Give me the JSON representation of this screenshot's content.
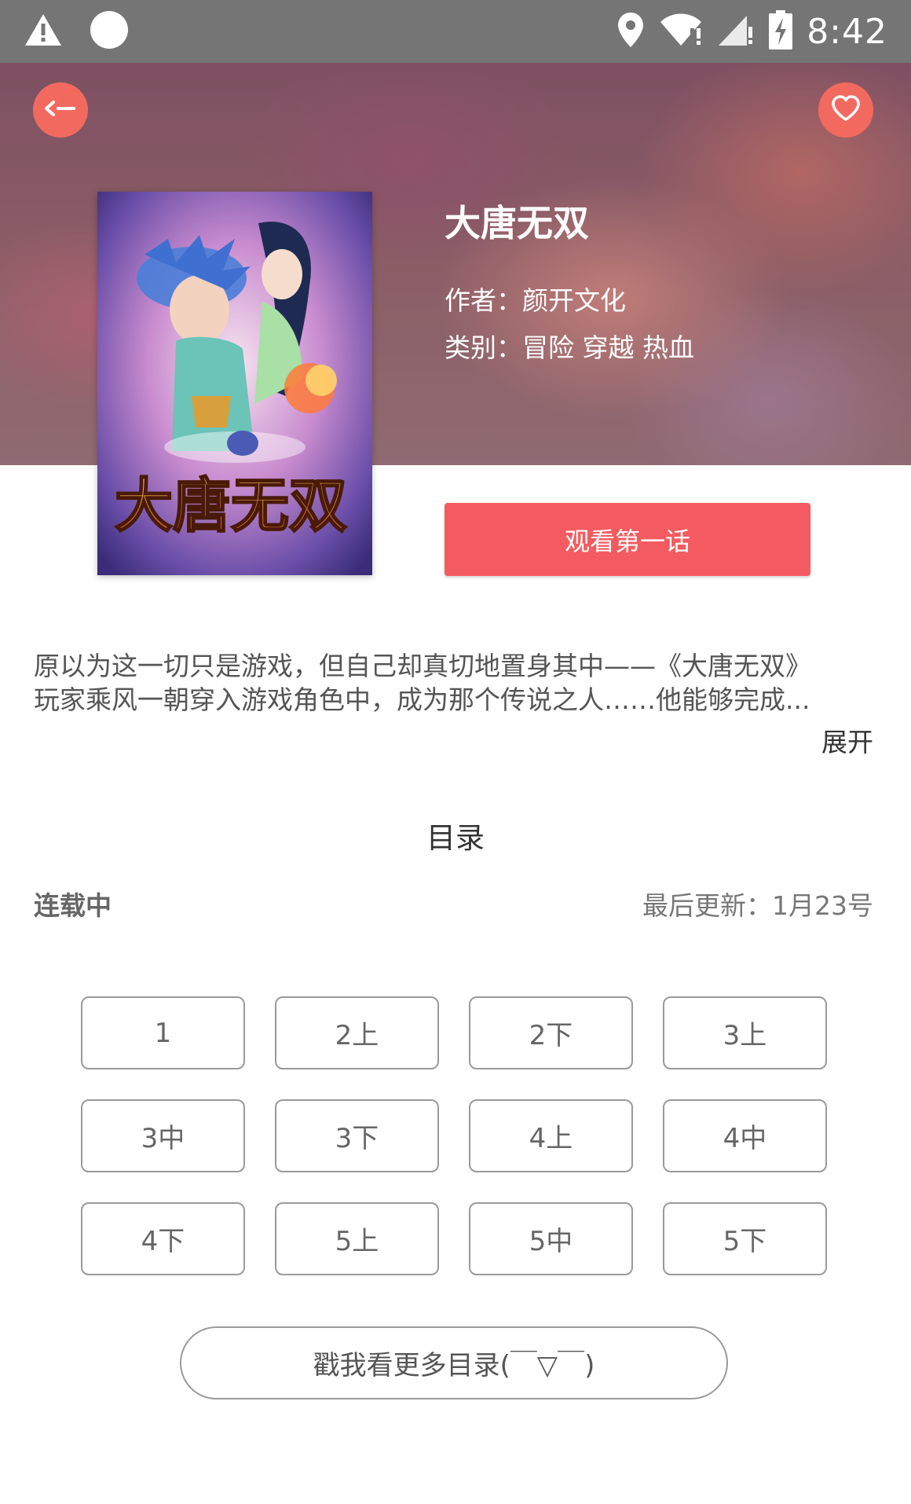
{
  "status_bar": {
    "time": "8:42",
    "icons": [
      "warning-icon",
      "circle-notification-icon",
      "location-icon",
      "wifi-icon",
      "signal-icon",
      "battery-icon"
    ]
  },
  "header": {
    "back_icon": "back-arrow-icon",
    "favorite_icon": "heart-icon",
    "accent_color": "#f26a5f"
  },
  "comic": {
    "title": "大唐无双",
    "author": "作者：颜开文化",
    "genre": "类别：冒险 穿越 热血",
    "cover_logo_text": "大唐无双",
    "watch_button_label": "观看第一话"
  },
  "synopsis": {
    "line1": "原以为这一切只是游戏，但自己却真切地置身其中——《大唐无双》",
    "line2": "玩家乘风一朝穿入游戏角色中，成为那个传说之人……他能够完成...",
    "expand_label": "展开"
  },
  "catalog": {
    "title": "目录",
    "status": "连载中",
    "last_update": "最后更新：1月23号",
    "chapters": [
      "1",
      "2上",
      "2下",
      "3上",
      "3中",
      "3下",
      "4上",
      "4中",
      "4下",
      "5上",
      "5中",
      "5下"
    ],
    "more_label": "戳我看更多目录(￣▽￣)"
  }
}
